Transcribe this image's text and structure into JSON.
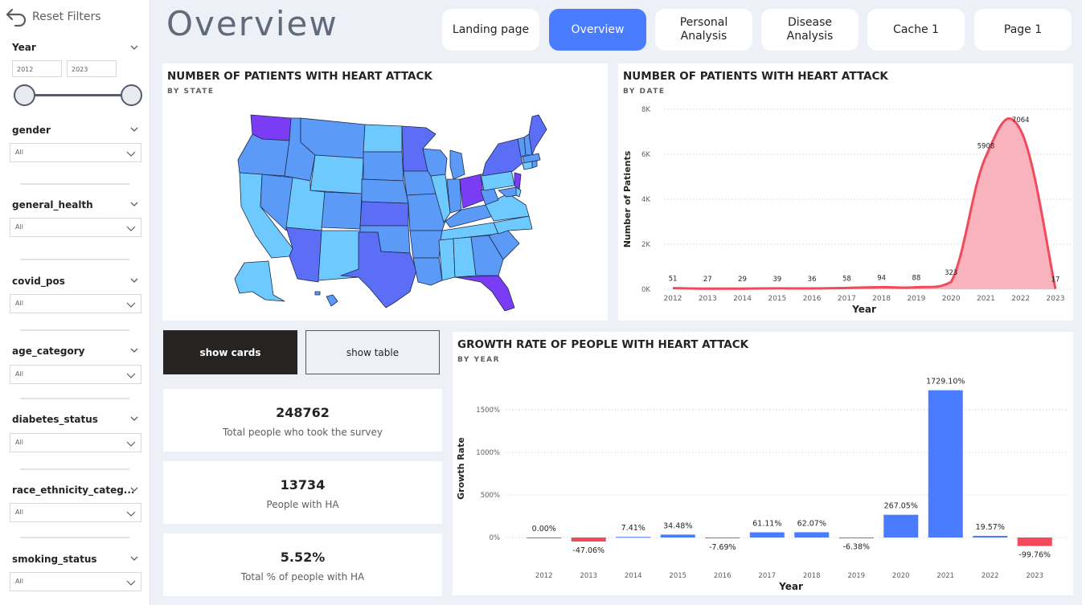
{
  "sidebar": {
    "reset_label": "Reset Filters",
    "year": {
      "title": "Year",
      "from": "2012",
      "to": "2023"
    },
    "slicers": [
      {
        "title": "gender",
        "value": "All"
      },
      {
        "title": "general_health",
        "value": "All"
      },
      {
        "title": "covid_pos",
        "value": "All"
      },
      {
        "title": "age_category",
        "value": "All"
      },
      {
        "title": "diabetes_status",
        "value": "All"
      },
      {
        "title": "race_ethnicity_categ...",
        "value": "All"
      },
      {
        "title": "smoking_status",
        "value": "All"
      }
    ]
  },
  "header": {
    "title": "Overview",
    "nav": [
      {
        "label": "Landing page",
        "active": false
      },
      {
        "label": "Overview",
        "active": true
      },
      {
        "label": "Personal\nAnalysis",
        "active": false
      },
      {
        "label": "Disease\nAnalysis",
        "active": false
      },
      {
        "label": "Cache 1",
        "active": false
      },
      {
        "label": "Page 1",
        "active": false
      }
    ]
  },
  "map_panel": {
    "title": "NUMBER OF PATIENTS WITH HEART ATTACK",
    "subtitle": "BY STATE"
  },
  "buttons": {
    "show_cards": "show cards",
    "show_table": "show table"
  },
  "cards": [
    {
      "value": "248762",
      "label": "Total people who took the survey"
    },
    {
      "value": "13734",
      "label": "People with HA"
    },
    {
      "value": "5.52%",
      "label": "Total % of people with HA"
    }
  ],
  "colors": {
    "accent": "#4a7cff",
    "negative": "#f2495c",
    "area_fill": "#f9b3bd",
    "map_light": "#6ec9ff",
    "map_dark": "#7b3cf5"
  },
  "chart_data": [
    {
      "type": "area",
      "title": "NUMBER OF PATIENTS WITH HEART ATTACK",
      "subtitle": "BY DATE",
      "xlabel": "Year",
      "ylabel": "Number of Patients",
      "categories": [
        "2012",
        "2013",
        "2014",
        "2015",
        "2016",
        "2017",
        "2018",
        "2019",
        "2020",
        "2021",
        "2022",
        "2023"
      ],
      "values": [
        51,
        27,
        29,
        39,
        36,
        58,
        94,
        88,
        323,
        5908,
        7064,
        17
      ],
      "data_labels": [
        "51",
        "27",
        "29",
        "39",
        "36",
        "58",
        "94",
        "88",
        "323",
        "5908",
        "7064",
        "17"
      ],
      "ylim": [
        0,
        8000
      ],
      "yticks": [
        0,
        2000,
        4000,
        6000,
        8000
      ],
      "ytick_labels": [
        "0K",
        "2K",
        "4K",
        "6K",
        "8K"
      ],
      "grid": true
    },
    {
      "type": "bar",
      "title": "GROWTH RATE OF PEOPLE WITH HEART ATTACK",
      "subtitle": "BY YEAR",
      "xlabel": "Year",
      "ylabel": "Growth Rate",
      "categories": [
        "2012",
        "2013",
        "2014",
        "2015",
        "2016",
        "2017",
        "2018",
        "2019",
        "2020",
        "2021",
        "2022",
        "2023"
      ],
      "values": [
        0.0,
        -47.06,
        7.41,
        34.48,
        -7.69,
        61.11,
        62.07,
        -6.38,
        267.05,
        1729.1,
        19.57,
        -99.76
      ],
      "data_labels": [
        "0.00%",
        "-47.06%",
        "7.41%",
        "34.48%",
        "-7.69%",
        "61.11%",
        "62.07%",
        "-6.38%",
        "267.05%",
        "1729.10%",
        "19.57%",
        "-99.76%"
      ],
      "yticks": [
        0,
        500,
        1000,
        1500
      ],
      "ytick_labels": [
        "0%",
        "500%",
        "1000%",
        "1500%"
      ],
      "ylim": [
        -200,
        1800
      ],
      "grid": true
    }
  ]
}
